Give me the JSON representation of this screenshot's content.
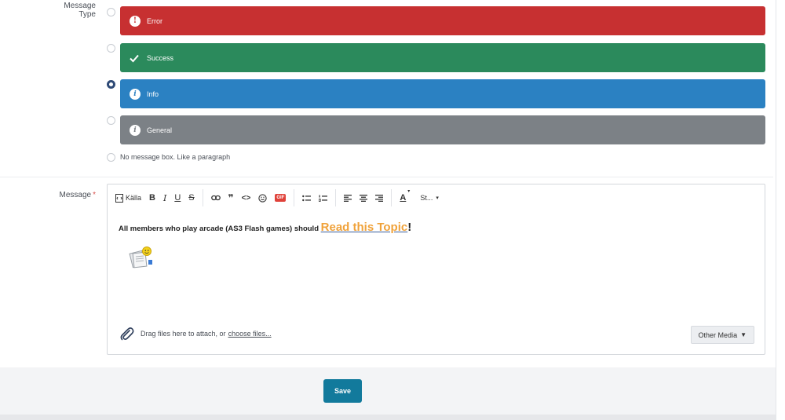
{
  "message_type": {
    "label": "Message Type",
    "options": [
      {
        "label": "Error",
        "color": "#c73031",
        "icon": "exclamation-icon",
        "selected": false
      },
      {
        "label": "Success",
        "color": "#2b8a5c",
        "icon": "check-icon",
        "selected": false
      },
      {
        "label": "Info",
        "color": "#2b81c2",
        "icon": "info-icon",
        "selected": true
      },
      {
        "label": "General",
        "color": "#7c8186",
        "icon": "info-icon",
        "selected": false
      }
    ],
    "no_box_label": "No message box. Like a paragraph"
  },
  "message": {
    "label": "Message",
    "required_mark": "*",
    "toolbar": {
      "source_label": "Källa",
      "bold": "B",
      "italic": "I",
      "underline": "U",
      "strike": "S",
      "quote": "❞",
      "code": "<>",
      "gif": "GIF",
      "font_color": "A",
      "style_label": "St..."
    },
    "content_text": "All members who play arcade  (AS3 Flash games) should ",
    "link_text": "Read this Topic",
    "trailing": "!",
    "attach_text": "Drag files here to attach, or",
    "choose_files": "choose files...",
    "other_media": "Other Media"
  },
  "save_label": "Save"
}
